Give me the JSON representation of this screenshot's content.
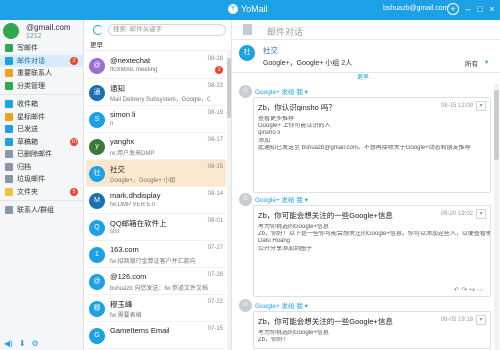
{
  "titlebar": {
    "app_name": "YoMail",
    "account": "bshuazb@gmail.com",
    "plus_icon": "+",
    "min_icon": "–",
    "max_icon": "□",
    "close_icon": "×"
  },
  "sidebar": {
    "account_email": "@gmail.com",
    "account_count": "1212",
    "items": [
      {
        "label": "写邮件",
        "icon_color": "#2fa84f",
        "badge": ""
      },
      {
        "label": "邮件对话",
        "icon_color": "#1da1e6",
        "badge": "2"
      },
      {
        "label": "重要联系人",
        "icon_color": "#f0a020",
        "badge": ""
      },
      {
        "label": "分类管理",
        "icon_color": "#2fa84f",
        "badge": ""
      },
      {
        "label": "收件箱",
        "icon_color": "#1da1e6",
        "badge": ""
      },
      {
        "label": "星标邮件",
        "icon_color": "#f0a020",
        "badge": ""
      },
      {
        "label": "已发送",
        "icon_color": "#1da1e6",
        "badge": ""
      },
      {
        "label": "草稿箱",
        "icon_color": "#1da1e6",
        "badge": "10"
      },
      {
        "label": "已删除邮件",
        "icon_color": "#8a96a3",
        "badge": ""
      },
      {
        "label": "归档",
        "icon_color": "#8a96a3",
        "badge": ""
      },
      {
        "label": "垃圾邮件",
        "icon_color": "#8a96a3",
        "badge": ""
      },
      {
        "label": "文件夹",
        "icon_color": "#f0c040",
        "badge": "5"
      },
      {
        "label": "联系人/群组",
        "icon_color": "#8a96a3",
        "badge": ""
      }
    ],
    "bottom_icons": [
      "◀)",
      "⬇",
      "⚙"
    ]
  },
  "list": {
    "search_placeholder": "搜索: 邮件关键字",
    "group_head": "更早",
    "items": [
      {
        "name": "@nextechat",
        "sub": "ff0XMAIL meeting",
        "date": "08-28",
        "count": "2",
        "avatar_color": "#9a6fd0",
        "avatar_text": "@"
      },
      {
        "name": "通知",
        "sub": "Mail Delivery Subsystem，Google，Goog",
        "date": "08-23",
        "count": "",
        "avatar_color": "#1b6fb5",
        "avatar_text": "通"
      },
      {
        "name": "simon li",
        "sub": "n",
        "date": "08-19",
        "count": "",
        "avatar_color": "#1da1e6",
        "avatar_text": "S"
      },
      {
        "name": "yanghx",
        "sub": "re:用户发来DMP",
        "date": "08-17",
        "count": "",
        "avatar_color": "#3b7a3b",
        "avatar_text": "y"
      },
      {
        "name": "社交",
        "sub": "Google+，Google+ 小组",
        "date": "08-15",
        "count": "",
        "avatar_color": "#1da1e6",
        "avatar_text": "社"
      },
      {
        "name": "mark.dhdisplay",
        "sub": "fw:DMP VER 5.0",
        "date": "08-14",
        "count": "",
        "avatar_color": "#1b6fb5",
        "avatar_text": "M"
      },
      {
        "name": "QQ邮箱在软件上",
        "sub": "sfsf",
        "date": "08-01",
        "count": "",
        "avatar_color": "#1da1e6",
        "avatar_text": "Q"
      },
      {
        "name": "163.com",
        "sub": "fw:招商银行金算证客户并汇款向",
        "date": "07-27",
        "count": "",
        "avatar_color": "#1da1e6",
        "avatar_text": "1"
      },
      {
        "name": "@126.com",
        "sub": "bshuazb 向您发送：fw:参道文件文档",
        "date": "07-26",
        "count": "",
        "avatar_color": "#1da1e6",
        "avatar_text": "@"
      },
      {
        "name": "穆玉峰",
        "sub": "fw:需要表格",
        "date": "07-22",
        "count": "",
        "avatar_color": "#1da1e6",
        "avatar_text": "穆"
      },
      {
        "name": "GameItems Email",
        "sub": "",
        "date": "07-15",
        "count": "",
        "avatar_color": "#1da1e6",
        "avatar_text": "G"
      }
    ]
  },
  "reader": {
    "top_title": "邮件对话",
    "conv_title": "社交",
    "conv_members": "Google+，Google+ 小组  2人",
    "filter_all": "所有",
    "filter_caret": "▾",
    "date_sep": "更早",
    "messages": [
      {
        "from": "Google+ 发给 我 ▾",
        "subject": "Zb，你认识qinsho 吗？",
        "date": "08-15 12:09",
        "more": "▾",
        "lines": [
          "查看更多推荐",
          "Google+ 上你可能认识的人",
          "qinsho li",
          "添加",
          "此通知已发送至 bshuazb@gmail.com。不想再接收关于Google+动态和朋友推荐"
        ],
        "actions": ""
      },
      {
        "from": "Google+ 发给 我 ▾",
        "subject": "Zb，你可能会想关注的一些Google+信息",
        "date": "06-20 19:02",
        "more": "▾",
        "lines": [
          "考为你挑选的Google+信息",
          "Zb，你好！以下是一些你可能会想关注的Google+信息。你可以添加这些人，以便查看他们发布的更多信息",
          "Dafu Huang",
          "公开分享添加到圈子"
        ],
        "actions": "↶ ↷ ↪ ⋯"
      },
      {
        "from": "Google+ 发给 我 ▾",
        "subject": "Zb，你可能会想关注的一些Google+信息",
        "date": "06-05 19:18",
        "more": "▾",
        "lines": [
          "考为你挑选的Google+信息",
          "Zb，你好！"
        ],
        "actions": ""
      }
    ]
  }
}
